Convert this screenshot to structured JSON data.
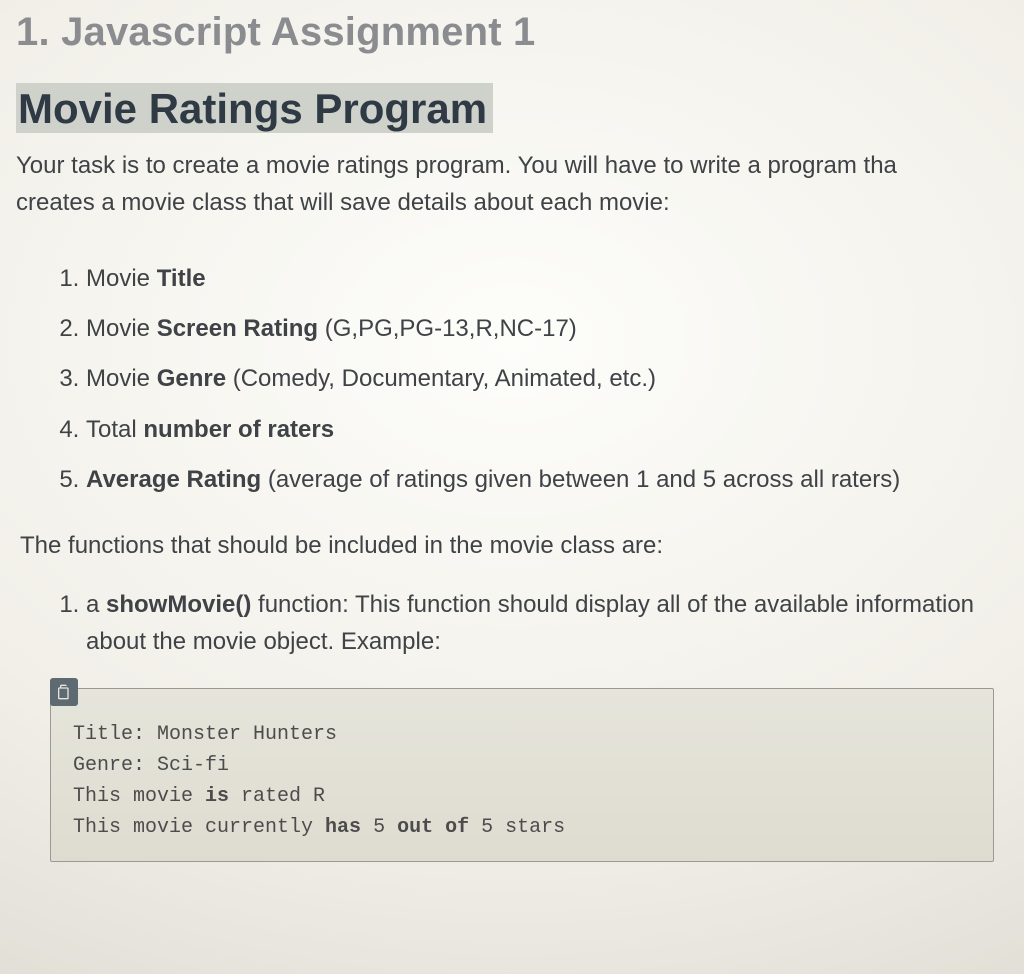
{
  "heading1": "1. Javascript Assignment 1",
  "heading2": "Movie Ratings Program",
  "intro": "Your task is to create a movie ratings program. You will have to write a program tha",
  "intro2": "creates a movie class that will save details about each movie:",
  "props": [
    {
      "pre": "Movie ",
      "bold": "Title",
      "post": ""
    },
    {
      "pre": "Movie ",
      "bold": "Screen Rating",
      "post": " (G,PG,PG-13,R,NC-17)"
    },
    {
      "pre": "Movie ",
      "bold": "Genre",
      "post": " (Comedy, Documentary, Animated, etc.)"
    },
    {
      "pre": "Total ",
      "bold": "number of raters",
      "post": ""
    },
    {
      "pre": "",
      "bold": "Average Rating",
      "post": " (average of ratings given between 1 and 5 across all raters)"
    }
  ],
  "mid": "The functions that should be included in the movie class are:",
  "funcs": [
    {
      "pre": "a ",
      "bold": "showMovie()",
      "post": " function: This function should display all of the available information about the movie object. Example:"
    }
  ],
  "code": {
    "l1a": "Title: Monster Hunters",
    "l2a": "Genre: Sci-fi",
    "l3a": "This movie ",
    "l3b": "is",
    "l3c": " rated R",
    "l4a": "This movie currently ",
    "l4b": "has",
    "l4c": " 5 ",
    "l4d": "out of",
    "l4e": " 5 stars"
  }
}
